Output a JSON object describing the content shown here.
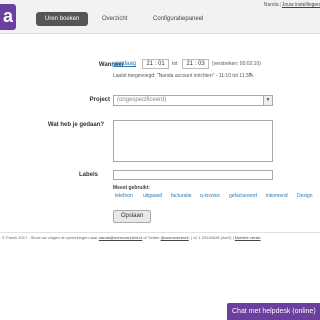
{
  "header": {
    "logo": "a",
    "tabs": [
      {
        "label": "Uren boeken"
      },
      {
        "label": "Overzicht"
      },
      {
        "label": "Configuratiepaneel"
      }
    ],
    "user_name": "Nanda",
    "user_settings": "Jouw instellingen"
  },
  "form": {
    "wanneer_label": "Wanneer",
    "date_link": "vandaag",
    "start_time": "21 : 01",
    "tot": "tot",
    "end_time": "21 : 03",
    "elapsed": "(verstreken: 00:02:10)",
    "last_modified": "Laatst toegevoegd: \"Nanda account inrichten\" - 11:10 tot 11:30.",
    "project_label": "Project",
    "project_value": "(ongespecificeerd)",
    "description_label": "Wat heb je gedaan?",
    "labels_label": "Labels",
    "most_used_label": "Meest gebruikt:",
    "tags": [
      "telefoon",
      "uitgaand",
      "facturatie",
      "q-invoice",
      "gefactureerd",
      "inkomend",
      "Design"
    ],
    "submit_label": "Opslaan"
  },
  "footer": {
    "text_prefix": "© Praxis 2017 - Stuur uw vragen of opmerkingen naar ",
    "email": "nanda@urenoverzicht.nl",
    "text_mid": " of Twitter ",
    "twitter": "@urenoverzicht",
    "version": ". | v2.1.20140628 (live2) | ",
    "mobile": "Mobiele versie"
  },
  "help_button": "Chat met helpdesk (online)"
}
